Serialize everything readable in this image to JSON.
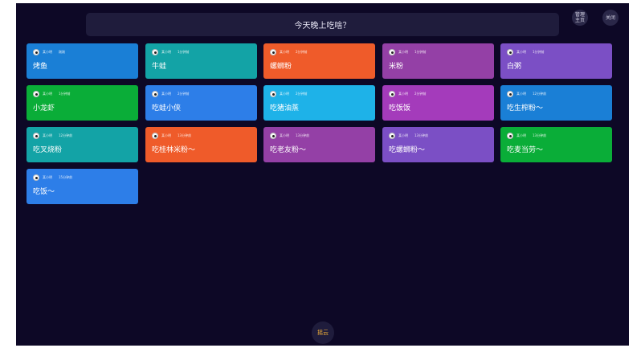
{
  "header": {
    "title": "今天晚上吃啥？"
  },
  "buttons": {
    "top_a": "管理\n主页",
    "top_b": "关闭",
    "bottom": "摇云"
  },
  "cards": [
    {
      "title": "烤鱼",
      "author": "某小明",
      "time": "刚刚",
      "color": "#1a7fd6"
    },
    {
      "title": "牛蛙",
      "author": "某小明",
      "time": "1分钟前",
      "color": "#13a3a6"
    },
    {
      "title": "螺蛳粉",
      "author": "某小明",
      "time": "2分钟前",
      "color": "#ef5b2a"
    },
    {
      "title": "米粉",
      "author": "某小明",
      "time": "1分钟前",
      "color": "#9440a6"
    },
    {
      "title": "白粥",
      "author": "某小明",
      "time": "1分钟前",
      "color": "#7b4fc5"
    },
    {
      "title": "小龙虾",
      "author": "某小明",
      "time": "1分钟前",
      "color": "#0aad38"
    },
    {
      "title": "吃蛙小侠",
      "author": "某小明",
      "time": "2分钟前",
      "color": "#2d7ee8"
    },
    {
      "title": "吃猪油蒸",
      "author": "某小明",
      "time": "2分钟前",
      "color": "#1eb2e8"
    },
    {
      "title": "吃饭饭",
      "author": "某小明",
      "time": "2分钟前",
      "color": "#a43bbb"
    },
    {
      "title": "吃生榨粉～",
      "author": "某小明",
      "time": "12分钟前",
      "color": "#1a7fd6"
    },
    {
      "title": "吃叉烧粉",
      "author": "某小明",
      "time": "12分钟前",
      "color": "#13a3a6"
    },
    {
      "title": "吃桂林米粉～",
      "author": "某小明",
      "time": "13分钟前",
      "color": "#ef5b2a"
    },
    {
      "title": "吃老友粉～",
      "author": "某小明",
      "time": "13分钟前",
      "color": "#9440a6"
    },
    {
      "title": "吃螺蛳粉～",
      "author": "某小明",
      "time": "13分钟前",
      "color": "#7b4fc5"
    },
    {
      "title": "吃麦当劳～",
      "author": "某小明",
      "time": "13分钟前",
      "color": "#0aad38"
    },
    {
      "title": "吃饭～",
      "author": "某小明",
      "time": "15分钟前",
      "color": "#2d7ee8"
    }
  ]
}
